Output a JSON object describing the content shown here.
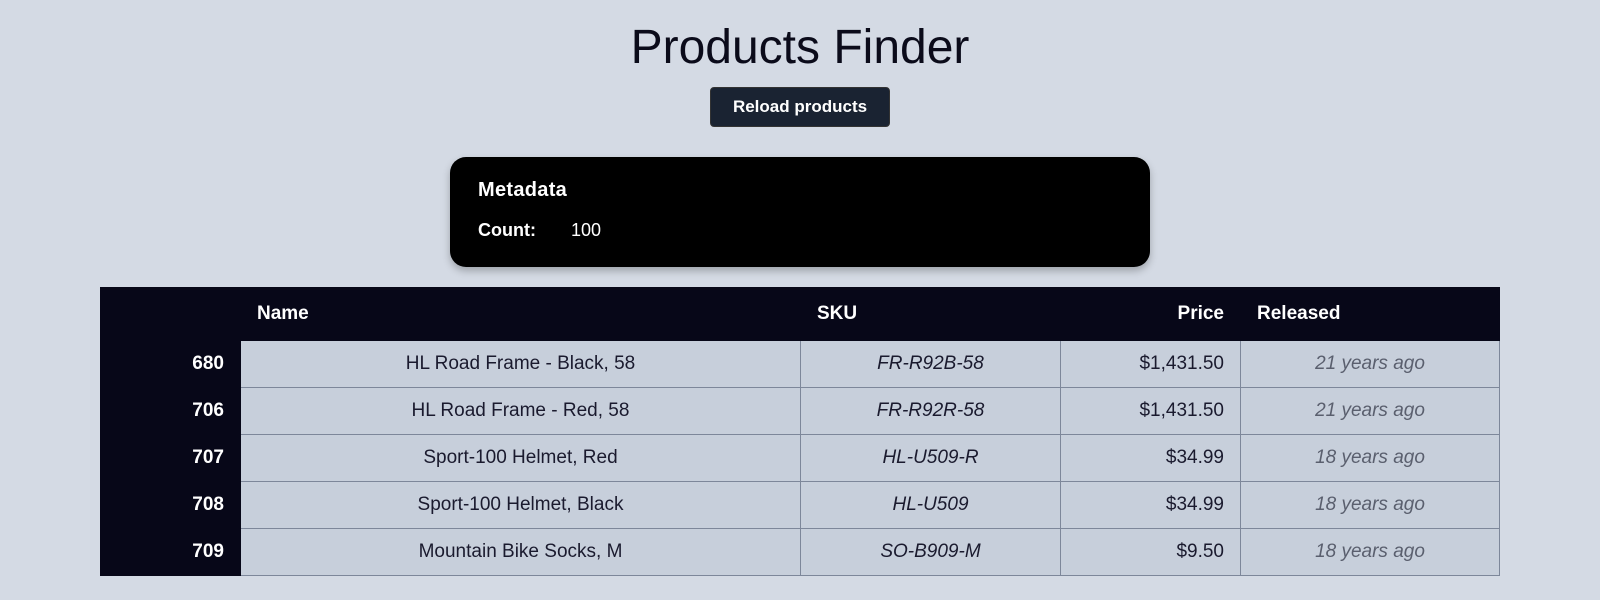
{
  "header": {
    "title": "Products Finder",
    "reload_label": "Reload products"
  },
  "metadata": {
    "title": "Metadata",
    "count_label": "Count:",
    "count_value": "100"
  },
  "table": {
    "columns": {
      "id": "",
      "name": "Name",
      "sku": "SKU",
      "price": "Price",
      "released": "Released"
    },
    "rows": [
      {
        "id": "680",
        "name": "HL Road Frame - Black, 58",
        "sku": "FR-R92B-58",
        "price": "$1,431.50",
        "released": "21 years ago"
      },
      {
        "id": "706",
        "name": "HL Road Frame - Red, 58",
        "sku": "FR-R92R-58",
        "price": "$1,431.50",
        "released": "21 years ago"
      },
      {
        "id": "707",
        "name": "Sport-100 Helmet, Red",
        "sku": "HL-U509-R",
        "price": "$34.99",
        "released": "18 years ago"
      },
      {
        "id": "708",
        "name": "Sport-100 Helmet, Black",
        "sku": "HL-U509",
        "price": "$34.99",
        "released": "18 years ago"
      },
      {
        "id": "709",
        "name": "Mountain Bike Socks, M",
        "sku": "SO-B909-M",
        "price": "$9.50",
        "released": "18 years ago"
      }
    ]
  }
}
